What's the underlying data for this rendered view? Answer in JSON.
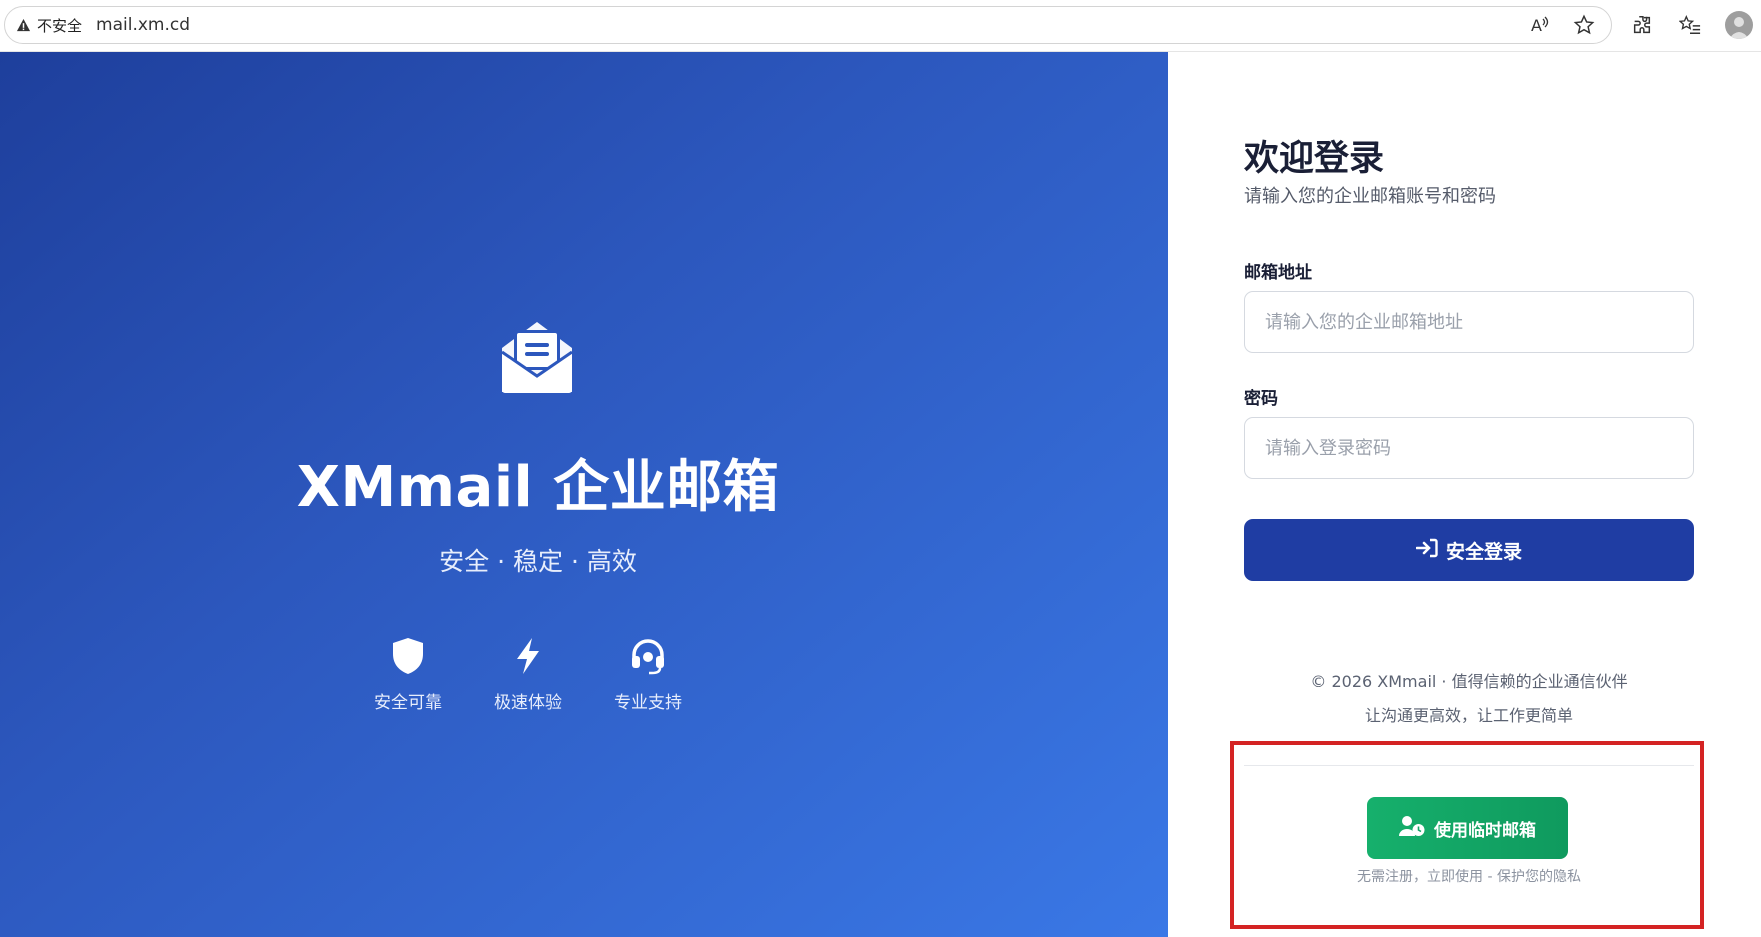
{
  "browser": {
    "security_label": "不安全",
    "url": "mail.xm.cd",
    "icons": [
      "read-aloud-icon",
      "favorite-star-icon",
      "extensions-icon",
      "favorites-list-icon",
      "profile-avatar-icon"
    ]
  },
  "hero": {
    "title": "XMmail 企业邮箱",
    "tagline": "安全 · 稳定 · 高效",
    "features": [
      {
        "label": "安全可靠",
        "icon": "shield-icon"
      },
      {
        "label": "极速体验",
        "icon": "lightning-icon"
      },
      {
        "label": "专业支持",
        "icon": "headset-icon"
      }
    ]
  },
  "login": {
    "title": "欢迎登录",
    "subtitle": "请输入您的企业邮箱账号和密码",
    "email_label": "邮箱地址",
    "email_placeholder": "请输入您的企业邮箱地址",
    "email_value": "",
    "password_label": "密码",
    "password_placeholder": "请输入登录密码",
    "password_value": "",
    "submit_label": "安全登录",
    "footer_copyright": "© 2026 XMmail · 值得信赖的企业通信伙伴",
    "footer_slogan": "让沟通更高效，让工作更简单",
    "temp_mail_label": "使用临时邮箱",
    "temp_mail_hint": "无需注册，立即使用 - 保护您的隐私"
  },
  "colors": {
    "hero_gradient_start": "#1e3f9c",
    "hero_gradient_end": "#3a78e6",
    "primary_button": "#1f3da3",
    "temp_button": "#16b06c",
    "highlight_border": "#d42323"
  }
}
